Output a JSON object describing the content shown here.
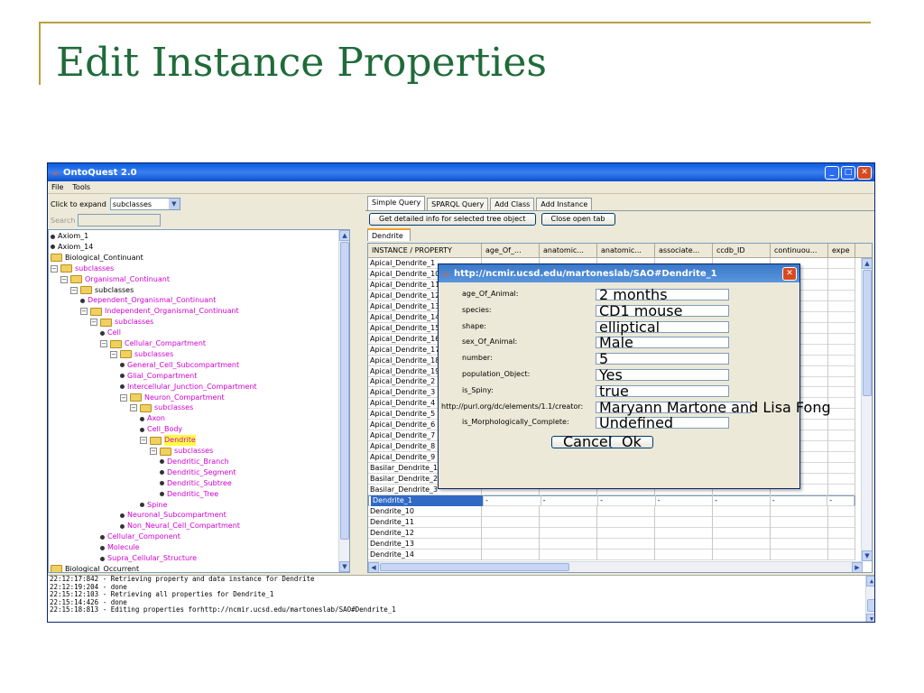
{
  "slide": {
    "title": "Edit Instance Properties"
  },
  "window": {
    "title": "OntoQuest 2.0",
    "controls": {
      "minimize": "_",
      "maximize": "□",
      "close": "✕"
    }
  },
  "menu": [
    "File",
    "Tools"
  ],
  "left": {
    "expand_label": "Click to expand",
    "expand_value": "subclasses",
    "search_placeholder": "Search",
    "tree": [
      {
        "label": "Axiom_1",
        "icon": "dot",
        "depth": 0
      },
      {
        "label": "Axiom_14",
        "icon": "dot",
        "depth": 0
      },
      {
        "label": "Biological_Continuant",
        "icon": "folder",
        "depth": 0
      },
      {
        "label": "subclasses",
        "icon": "folder",
        "depth": 0,
        "box": true,
        "color": "magenta"
      },
      {
        "label": "Organismal_Continuant",
        "icon": "folder",
        "depth": 1,
        "box": true,
        "color": "magenta"
      },
      {
        "label": "subclasses",
        "icon": "folder",
        "depth": 2,
        "box": true
      },
      {
        "label": "Dependent_Organismal_Continuant",
        "icon": "dot",
        "depth": 3,
        "color": "magenta"
      },
      {
        "label": "Independent_Organismal_Continuant",
        "icon": "folder",
        "depth": 3,
        "box": true,
        "color": "magenta"
      },
      {
        "label": "subclasses",
        "icon": "folder",
        "depth": 4,
        "box": true,
        "color": "magenta"
      },
      {
        "label": "Cell",
        "icon": "dot",
        "depth": 5,
        "color": "magenta"
      },
      {
        "label": "Cellular_Compartment",
        "icon": "folder",
        "depth": 5,
        "box": true,
        "color": "magenta"
      },
      {
        "label": "subclasses",
        "icon": "folder",
        "depth": 6,
        "box": true,
        "color": "magenta"
      },
      {
        "label": "General_Cell_Subcompartment",
        "icon": "dot",
        "depth": 7,
        "color": "magenta"
      },
      {
        "label": "Glial_Compartment",
        "icon": "dot",
        "depth": 7,
        "color": "magenta"
      },
      {
        "label": "Intercellular_Junction_Compartment",
        "icon": "dot",
        "depth": 7,
        "color": "magenta"
      },
      {
        "label": "Neuron_Compartment",
        "icon": "folder",
        "depth": 7,
        "box": true,
        "color": "magenta"
      },
      {
        "label": "subclasses",
        "icon": "folder",
        "depth": 8,
        "box": true,
        "color": "magenta"
      },
      {
        "label": "Axon",
        "icon": "dot",
        "depth": 9,
        "color": "magenta"
      },
      {
        "label": "Cell_Body",
        "icon": "dot",
        "depth": 9,
        "color": "magenta"
      },
      {
        "label": "Dendrite",
        "icon": "folder",
        "depth": 9,
        "box": true,
        "color": "magenta",
        "highlight": true
      },
      {
        "label": "subclasses",
        "icon": "folder",
        "depth": 10,
        "box": true,
        "color": "magenta"
      },
      {
        "label": "Dendritic_Branch",
        "icon": "dot",
        "depth": 11,
        "color": "magenta"
      },
      {
        "label": "Dendritic_Segment",
        "icon": "dot",
        "depth": 11,
        "color": "magenta"
      },
      {
        "label": "Dendritic_Subtree",
        "icon": "dot",
        "depth": 11,
        "color": "magenta"
      },
      {
        "label": "Dendritic_Tree",
        "icon": "dot",
        "depth": 11,
        "color": "magenta"
      },
      {
        "label": "Spine",
        "icon": "dot",
        "depth": 9,
        "color": "magenta"
      },
      {
        "label": "Neuronal_Subcompartment",
        "icon": "dot",
        "depth": 7,
        "color": "magenta"
      },
      {
        "label": "Non_Neural_Cell_Compartment",
        "icon": "dot",
        "depth": 7,
        "color": "magenta"
      },
      {
        "label": "Cellular_Component",
        "icon": "dot",
        "depth": 5,
        "color": "magenta"
      },
      {
        "label": "Molecule",
        "icon": "dot",
        "depth": 5,
        "color": "magenta"
      },
      {
        "label": "Supra_Cellular_Structure",
        "icon": "dot",
        "depth": 5,
        "color": "magenta"
      },
      {
        "label": "Biological_Occurrent",
        "icon": "folder",
        "depth": 0
      }
    ]
  },
  "right": {
    "tabs": [
      "Simple Query",
      "SPARQL Query",
      "Add Class",
      "Add Instance"
    ],
    "get_info_button": "Get detailed info for selected tree object",
    "close_tab_button": "Close open tab",
    "subtab": "Dendrite",
    "columns": [
      "INSTANCE / PROPERTY",
      "age_Of_...",
      "anatomic...",
      "anatomic...",
      "associate...",
      "ccdb_ID",
      "continuou...",
      "expe"
    ],
    "rows": [
      "Apical_Dendrite_1",
      "Apical_Dendrite_10",
      "Apical_Dendrite_11",
      "Apical_Dendrite_12",
      "Apical_Dendrite_13",
      "Apical_Dendrite_14",
      "Apical_Dendrite_15",
      "Apical_Dendrite_16",
      "Apical_Dendrite_17",
      "Apical_Dendrite_18",
      "Apical_Dendrite_19",
      "Apical_Dendrite_2",
      "Apical_Dendrite_3",
      "Apical_Dendrite_4",
      "Apical_Dendrite_5",
      "Apical_Dendrite_6",
      "Apical_Dendrite_7",
      "Apical_Dendrite_8",
      "Apical_Dendrite_9",
      "Basilar_Dendrite_1",
      "Basilar_Dendrite_2",
      "Basilar_Dendrite_3",
      "Dendrite_1",
      "Dendrite_10",
      "Dendrite_11",
      "Dendrite_12",
      "Dendrite_13",
      "Dendrite_14"
    ],
    "selected_row": "Dendrite_1",
    "selected_cell": "-"
  },
  "dialog": {
    "title": "http://ncmir.ucsd.edu/martoneslab/SAO#Dendrite_1",
    "properties": [
      {
        "label": "age_Of_Animal:",
        "value": "2 months"
      },
      {
        "label": "species:",
        "value": "CD1 mouse"
      },
      {
        "label": "shape:",
        "value": "elliptical"
      },
      {
        "label": "sex_Of_Animal:",
        "value": "Male"
      },
      {
        "label": "number:",
        "value": "5"
      },
      {
        "label": "population_Object:",
        "value": "Yes"
      },
      {
        "label": "is_Spiny:",
        "value": "true"
      },
      {
        "label": "http://purl.org/dc/elements/1.1/creator:",
        "value": "Maryann Martone and Lisa Fong"
      },
      {
        "label": "is_Morphologically_Complete:",
        "value": "Undefined"
      }
    ],
    "cancel": "Cancel",
    "ok": "Ok"
  },
  "log": [
    "22:12:17:842 - Retrieving property and data instance for Dendrite",
    "22:12:19:204 - done",
    "22:15:12:103 - Retrieving all properties for Dendrite_1",
    "22:15:14:426 - done",
    "22:15:18:813 - Editing properties forhttp://ncmir.ucsd.edu/martoneslab/SAO#Dendrite_1"
  ]
}
